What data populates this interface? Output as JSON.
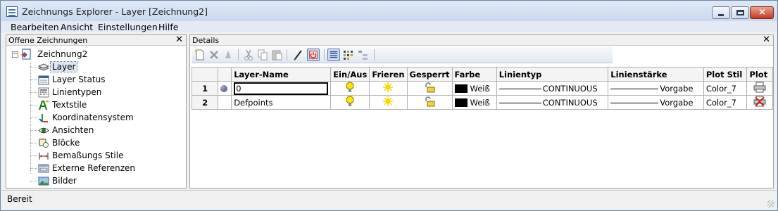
{
  "window": {
    "title": "Zeichnungs Explorer - Layer [Zeichnung2]",
    "close_glyph": "×"
  },
  "menu": [
    "Bearbeiten",
    "Ansicht",
    "Einstellungen",
    "Hilfe"
  ],
  "left_pane": {
    "title": "Offene Zeichnungen",
    "close_glyph": "✕",
    "root": "Zeichnung2",
    "expander": "−",
    "items": [
      "Layer",
      "Layer Status",
      "Linientypen",
      "Textstile",
      "Koordinatensystem",
      "Ansichten",
      "Blöcke",
      "Bemaßungs Stile",
      "Externe Referenzen",
      "Bilder"
    ]
  },
  "right_pane": {
    "title": "Details",
    "close_glyph": "✕"
  },
  "table": {
    "columns": [
      "",
      "",
      "Layer-Name",
      "Ein/Aus",
      "Frieren",
      "Gesperrt",
      "Farbe",
      "Linientyp",
      "Linienstärke",
      "Plot Stil",
      "Plot"
    ],
    "rows": [
      {
        "num": "1",
        "name": "0",
        "color": "Weiß",
        "linetype": "CONTINUOUS",
        "lineweight": "Vorgabe",
        "plotstyle": "Color_7"
      },
      {
        "num": "2",
        "name": "Defpoints",
        "color": "Weiß",
        "linetype": "CONTINUOUS",
        "lineweight": "Vorgabe",
        "plotstyle": "Color_7"
      }
    ]
  },
  "status": {
    "text": "Bereit"
  },
  "colors": {
    "accent": "#33489a",
    "selection": "#dce7f6",
    "freeze_sun": "#f5d800"
  }
}
